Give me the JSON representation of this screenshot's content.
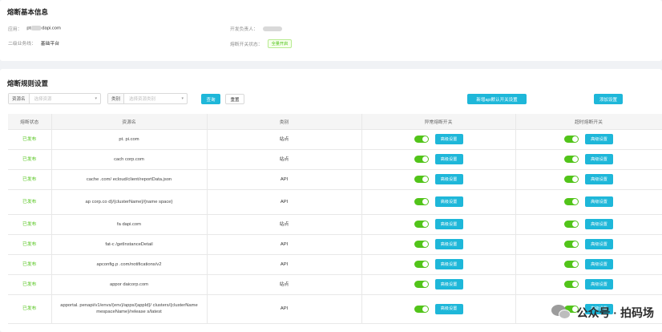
{
  "basic": {
    "title": "熔断基本信息",
    "app_label": "应用：",
    "app_value_prefix": "pt",
    "app_value_suffix": "dapi.com",
    "owner_label": "开发负责人：",
    "dept_label": "二级业务线：",
    "dept_value": "基础平台",
    "switch_label": "熔断开关状态：",
    "switch_value": "全量开启"
  },
  "rules": {
    "title": "熔断规则设置",
    "filter_resource_label": "资源名",
    "filter_resource_placeholder": "选择资源",
    "filter_category_label": "类别",
    "filter_category_placeholder": "选择资源类别",
    "search_button": "查询",
    "reset_button": "重置",
    "batch_button": "新增api默认开关设置",
    "add_button": "添加设置"
  },
  "table": {
    "headers": [
      "熔断状态",
      "资源名",
      "类别",
      "异常熔断开关",
      "超时熔断开关"
    ],
    "advanced_label": "高级设置",
    "rows": [
      {
        "status": "已发布",
        "name": "pt.         pi.com",
        "type": "站点"
      },
      {
        "status": "已发布",
        "name": "cach         corp.com",
        "type": "站点"
      },
      {
        "status": "已发布",
        "name": "cache        .com/      ecloud/client/reportData.json",
        "type": "API"
      },
      {
        "status": "已发布",
        "name": "ap         corp.co          d}/{clusterName}/{name space}",
        "type": "API"
      },
      {
        "status": "已发布",
        "name": "fa          dapi.com",
        "type": "站点"
      },
      {
        "status": "已发布",
        "name": "fat-c              /getInstanceDetail",
        "type": "API"
      },
      {
        "status": "已发布",
        "name": "apconfig.p         .com/notifications/v2",
        "type": "API"
      },
      {
        "status": "已发布",
        "name": "appor        daicorp.com",
        "type": "站点"
      },
      {
        "status": "已发布",
        "name": "apportal.       penapi/v1/envs/{env}/apps/{appId}/ clusters/{clusterName        mespaceName}/release s/latest",
        "type": "API"
      }
    ]
  },
  "watermark": {
    "text": "公众号 · 拍码场"
  }
}
